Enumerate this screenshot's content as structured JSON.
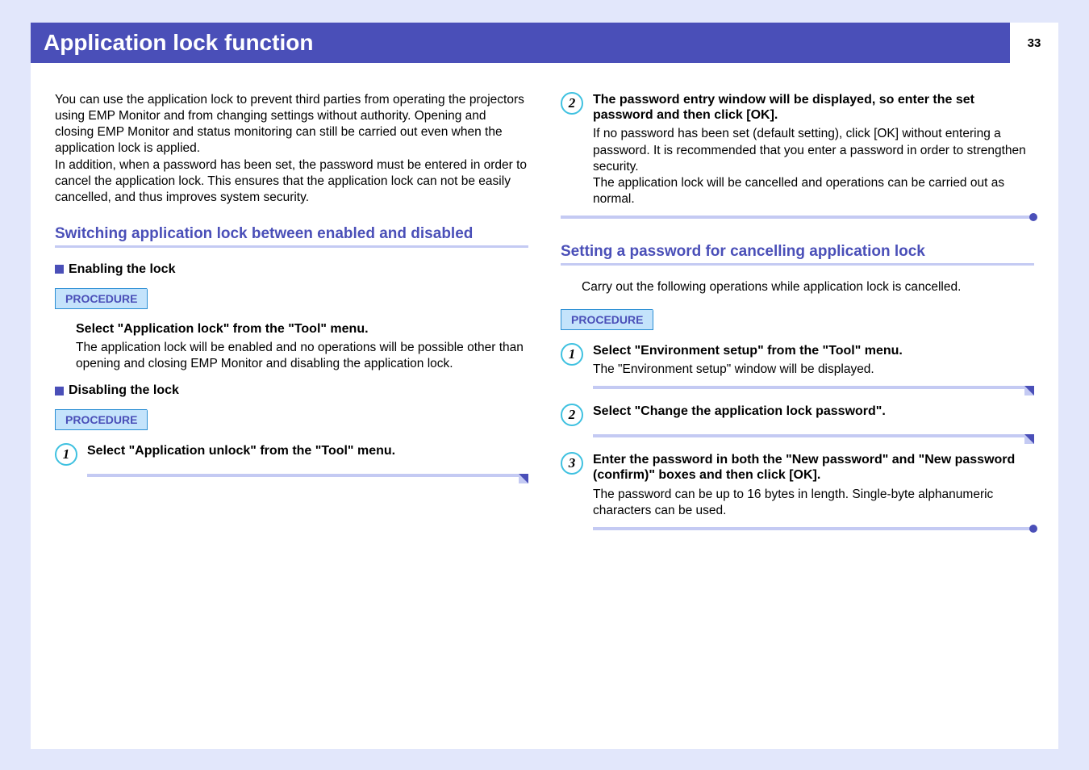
{
  "title": "Application lock function",
  "page_number": "33",
  "intro": "You can use the application lock to prevent third parties from operating the projectors using EMP Monitor and from changing settings without authority. Opening and closing EMP Monitor and status monitoring can still be carried out even when the application lock is applied.\nIn addition, when a password has been set, the password must be entered in order to cancel the application lock. This ensures that the application lock can not be easily cancelled, and thus improves system security.",
  "section1": {
    "heading": "Switching application lock between enabled and disabled",
    "sub1": "Enabling the lock",
    "proc_label": "PROCEDURE",
    "enable_step_h": "Select \"Application lock\" from the \"Tool\" menu.",
    "enable_step_body": "The application lock will be enabled and no operations will be possible other than opening and closing EMP Monitor and disabling the application lock.",
    "sub2": "Disabling the lock",
    "disable_steps": {
      "s1": {
        "n": "1",
        "h": "Select \"Application unlock\" from the \"Tool\" menu."
      },
      "s2": {
        "n": "2",
        "h": "The password entry window will be displayed, so enter the set password and then click [OK].",
        "body1": "If no password has been set (default setting), click [OK] without entering a password. It is recommended that you enter a password in order to strengthen security.",
        "body2": "The application lock will be cancelled and operations can be carried out as normal."
      }
    }
  },
  "section2": {
    "heading": "Setting a password for cancelling application lock",
    "note": "Carry out the following operations while application lock is cancelled.",
    "proc_label": "PROCEDURE",
    "steps": {
      "s1": {
        "n": "1",
        "h": "Select \"Environment setup\" from the \"Tool\" menu.",
        "body": "The \"Environment setup\" window will be displayed."
      },
      "s2": {
        "n": "2",
        "h": "Select \"Change the application lock password\"."
      },
      "s3": {
        "n": "3",
        "h": "Enter the password in both the \"New password\" and \"New password (confirm)\" boxes and then click [OK].",
        "body": "The password can be up to 16 bytes in length. Single-byte alphanumeric characters can be used."
      }
    }
  }
}
